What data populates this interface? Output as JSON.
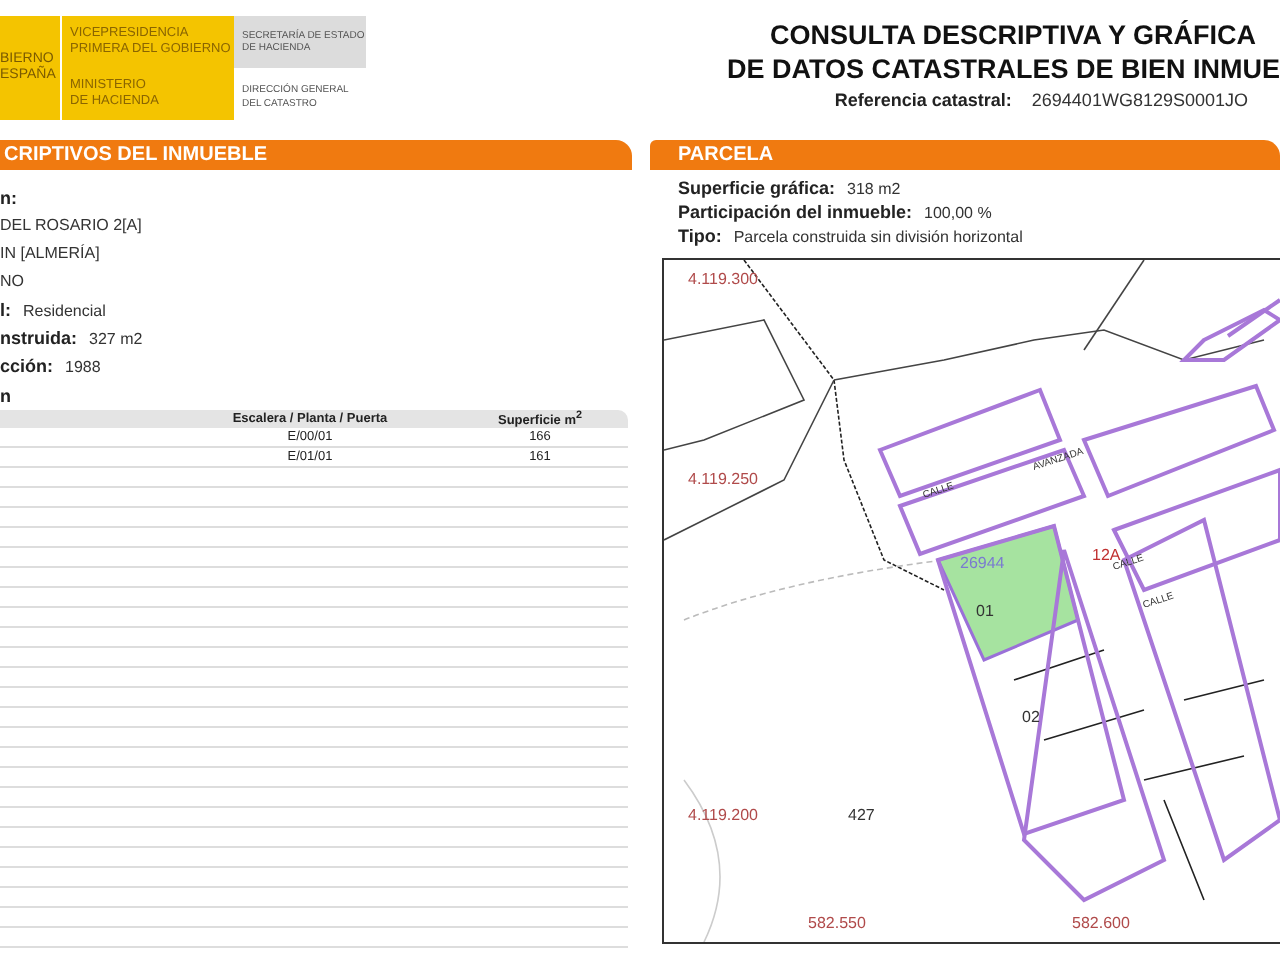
{
  "header": {
    "gov_lines": [
      "BIERNO",
      "ESPAÑA"
    ],
    "vice_lines": [
      "VICEPRESIDENCIA",
      "PRIMERA DEL GOBIERNO"
    ],
    "ministry_lines": [
      "MINISTERIO",
      "DE HACIENDA"
    ],
    "secretary_lines": [
      "SECRETARÍA DE ESTADO",
      "DE HACIENDA"
    ],
    "direction_lines": [
      "DIRECCIÓN GENERAL",
      "DEL CATASTRO"
    ]
  },
  "title": {
    "lines": [
      "CONSULTA DESCRIPTIVA Y GRÁFICA",
      "DE DATOS CATASTRALES DE BIEN INMUE"
    ],
    "reference_label": "Referencia catastral:",
    "reference_value": "2694401WG8129S0001JO"
  },
  "inmueble": {
    "heading": "CRIPTIVOS DEL INMUEBLE",
    "fields": [
      {
        "label": "n:"
      },
      {
        "value": "DEL ROSARIO 2[A]"
      },
      {
        "value": "IN [ALMERÍA]"
      },
      {
        "value": "NO"
      },
      {
        "label": "l:",
        "value": "Residencial"
      },
      {
        "label": "nstruida:",
        "value": "327 m2"
      },
      {
        "label": "cción:",
        "value": "1988"
      }
    ],
    "construction": {
      "heading": "n",
      "columns": [
        "Escalera / Planta / Puerta",
        "Superficie m$^{2}$"
      ],
      "rows": [
        [
          "E/00/01",
          "166"
        ],
        [
          "E/01/01",
          "161"
        ]
      ]
    }
  },
  "parcela": {
    "heading": "PARCELA",
    "fields": [
      {
        "label": "Superficie gráfica:",
        "value": "318 m2"
      },
      {
        "label": "Participación del inmueble:",
        "value": "100,00 %"
      },
      {
        "label": "Tipo:",
        "value": "Parcela construida sin división horizontal"
      }
    ],
    "map": {
      "coordinate_labels": [
        "4.119.300",
        "4.119.250",
        "4.119.200",
        "582.550",
        "582.600"
      ],
      "parcel_labels": [
        "26944",
        "01",
        "02",
        "427",
        "12A"
      ],
      "street_labels": [
        "CALLE",
        "CALLE",
        "CALLE",
        "AVANZADA"
      ]
    }
  }
}
